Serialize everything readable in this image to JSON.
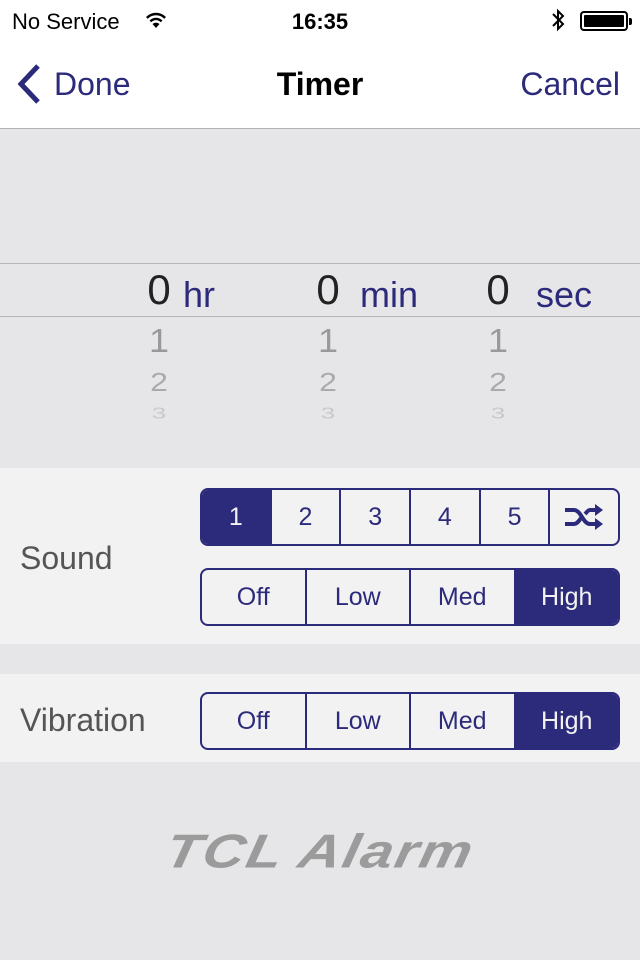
{
  "status_bar": {
    "carrier": "No Service",
    "time": "16:35",
    "wifi_icon": "wifi-icon",
    "bluetooth_icon": "bluetooth-icon",
    "battery_icon": "battery-icon",
    "battery_level_percent": 100
  },
  "nav": {
    "back_label": "Done",
    "back_icon": "chevron-left-icon",
    "title": "Timer",
    "cancel_label": "Cancel"
  },
  "picker": {
    "columns": [
      {
        "name": "hours",
        "selected": "0",
        "unit": "hr",
        "below": [
          "1",
          "2",
          "3"
        ]
      },
      {
        "name": "minutes",
        "selected": "0",
        "unit": "min",
        "below": [
          "1",
          "2",
          "3"
        ]
      },
      {
        "name": "seconds",
        "selected": "0",
        "unit": "sec",
        "below": [
          "1",
          "2",
          "3"
        ]
      }
    ]
  },
  "sound": {
    "label": "Sound",
    "tones": [
      {
        "label": "1",
        "active": true
      },
      {
        "label": "2",
        "active": false
      },
      {
        "label": "3",
        "active": false
      },
      {
        "label": "4",
        "active": false
      },
      {
        "label": "5",
        "active": false
      },
      {
        "label": "",
        "icon": "shuffle-icon",
        "active": false
      }
    ],
    "levels": [
      {
        "label": "Off",
        "active": false
      },
      {
        "label": "Low",
        "active": false
      },
      {
        "label": "Med",
        "active": false
      },
      {
        "label": "High",
        "active": true
      }
    ]
  },
  "vibration": {
    "label": "Vibration",
    "levels": [
      {
        "label": "Off",
        "active": false
      },
      {
        "label": "Low",
        "active": false
      },
      {
        "label": "Med",
        "active": false
      },
      {
        "label": "High",
        "active": true
      }
    ]
  },
  "logo": {
    "text": "TCL Alarm"
  },
  "colors": {
    "accent": "#2c2a7a",
    "background": "#e6e6e8",
    "section": "#f2f2f2",
    "logo": "#9b9b9b"
  }
}
